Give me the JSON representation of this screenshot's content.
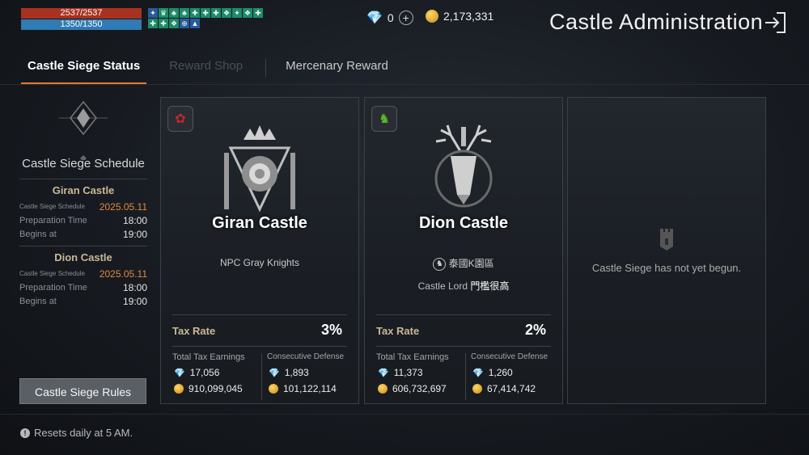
{
  "hud": {
    "hp": "2537/2537",
    "mp": "1350/1350",
    "buffs": [
      "✦",
      "♛",
      "♣",
      "♣",
      "✚",
      "✚",
      "✚",
      "❖",
      "✦",
      "❖",
      "✚",
      "✚",
      "✚",
      "❖",
      "⊕",
      "▲"
    ]
  },
  "currency": {
    "diamonds": "0",
    "gold": "2,173,331"
  },
  "header": {
    "title": "Castle Administration"
  },
  "tabs": {
    "siege_status": "Castle Siege Status",
    "reward_shop": "Reward Shop",
    "mercenary_reward": "Mercenary Reward"
  },
  "schedule": {
    "title": "Castle Siege Schedule",
    "castles": [
      {
        "name": "Giran Castle",
        "schedule_label": "Castle Siege Schedule",
        "date": "2025.05.11",
        "prep_label": "Preparation Time",
        "prep_time": "18:00",
        "begins_label": "Begins at",
        "begins_time": "19:00"
      },
      {
        "name": "Dion Castle",
        "schedule_label": "Castle Siege Schedule",
        "date": "2025.05.11",
        "prep_label": "Preparation Time",
        "prep_time": "18:00",
        "begins_label": "Begins at",
        "begins_time": "19:00"
      }
    ],
    "rules_button": "Castle Siege Rules"
  },
  "cards": [
    {
      "name": "Giran Castle",
      "owner": "NPC Gray Knights",
      "tax_label": "Tax Rate",
      "tax": "3%",
      "earnings_label": "Total Tax Earnings",
      "earn_diamonds": "17,056",
      "earn_gold": "910,099,045",
      "defense_label": "Consecutive Defense",
      "def_diamonds": "1,893",
      "def_gold": "101,122,114",
      "accent": "#c0282a"
    },
    {
      "name": "Dion Castle",
      "clan": "泰國K園區",
      "lord_label": "Castle Lord",
      "lord": "門檻很高",
      "tax_label": "Tax Rate",
      "tax": "2%",
      "earnings_label": "Total Tax Earnings",
      "earn_diamonds": "11,373",
      "earn_gold": "606,732,697",
      "defense_label": "Consecutive Defense",
      "def_diamonds": "1,260",
      "def_gold": "67,414,742",
      "accent": "#4a9a1a"
    },
    {
      "empty_text": "Castle Siege has not yet begun."
    }
  ],
  "footer": {
    "reset": "Resets daily at 5 AM."
  }
}
